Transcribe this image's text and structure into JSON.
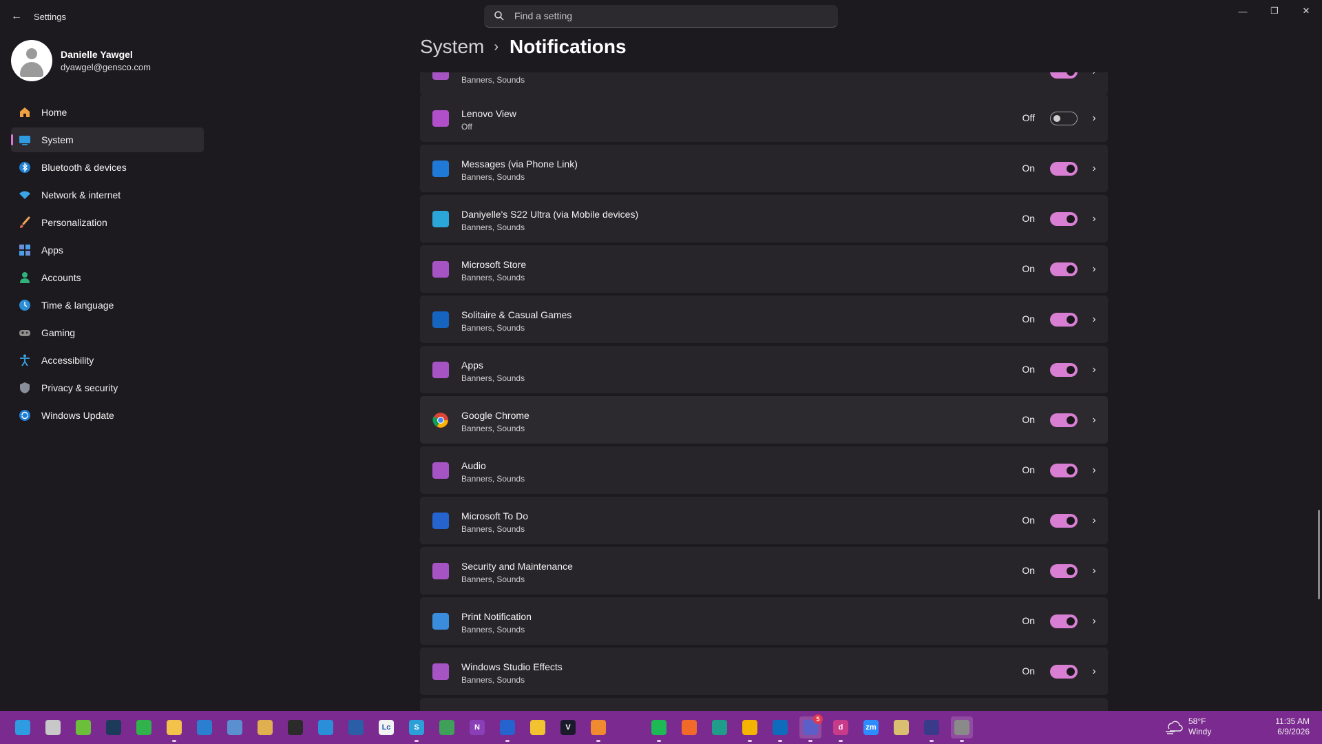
{
  "app": {
    "title": "Settings"
  },
  "search": {
    "placeholder": "Find a setting"
  },
  "profile": {
    "name": "Danielle Yawgel",
    "email": "dyawgel@gensco.com"
  },
  "nav": {
    "items": [
      {
        "label": "Home",
        "icon": "home-icon",
        "active": false
      },
      {
        "label": "System",
        "icon": "system-icon",
        "active": true
      },
      {
        "label": "Bluetooth & devices",
        "icon": "bluetooth-icon",
        "active": false
      },
      {
        "label": "Network & internet",
        "icon": "wifi-icon",
        "active": false
      },
      {
        "label": "Personalization",
        "icon": "brush-icon",
        "active": false
      },
      {
        "label": "Apps",
        "icon": "apps-icon",
        "active": false
      },
      {
        "label": "Accounts",
        "icon": "accounts-icon",
        "active": false
      },
      {
        "label": "Time & language",
        "icon": "globe-clock-icon",
        "active": false
      },
      {
        "label": "Gaming",
        "icon": "gamepad-icon",
        "active": false
      },
      {
        "label": "Accessibility",
        "icon": "accessibility-icon",
        "active": false
      },
      {
        "label": "Privacy & security",
        "icon": "shield-icon",
        "active": false
      },
      {
        "label": "Windows Update",
        "icon": "update-icon",
        "active": false
      }
    ]
  },
  "breadcrumb": {
    "parent": "System",
    "separator": "›",
    "current": "Notifications"
  },
  "notifications": {
    "partial_top": {
      "sub": "Banners, Sounds"
    },
    "apps": [
      {
        "name": "Lenovo View",
        "sub": "Off",
        "state": "Off",
        "on": false,
        "icon": "lenovo-view-icon",
        "color": "#b04fc9"
      },
      {
        "name": "Messages (via Phone Link)",
        "sub": "Banners, Sounds",
        "state": "On",
        "on": true,
        "icon": "phone-link-icon",
        "color": "#1e7ad6"
      },
      {
        "name": "Daniyelle's S22 Ultra (via Mobile devices)",
        "sub": "Banners, Sounds",
        "state": "On",
        "on": true,
        "icon": "mobile-device-icon",
        "color": "#2aa6d8"
      },
      {
        "name": "Microsoft Store",
        "sub": "Banners, Sounds",
        "state": "On",
        "on": true,
        "icon": "store-icon",
        "color": "#a653c4"
      },
      {
        "name": "Solitaire & Casual Games",
        "sub": "Banners, Sounds",
        "state": "On",
        "on": true,
        "icon": "solitaire-icon",
        "color": "#1565c0"
      },
      {
        "name": "Apps",
        "sub": "Banners, Sounds",
        "state": "On",
        "on": true,
        "icon": "apps-tile-icon",
        "color": "#a653c4"
      },
      {
        "name": "Google Chrome",
        "sub": "Banners, Sounds",
        "state": "On",
        "on": true,
        "icon": "chrome-icon",
        "color": "#ffffff"
      },
      {
        "name": "Audio",
        "sub": "Banners, Sounds",
        "state": "On",
        "on": true,
        "icon": "audio-icon",
        "color": "#a653c4"
      },
      {
        "name": "Microsoft To Do",
        "sub": "Banners, Sounds",
        "state": "On",
        "on": true,
        "icon": "todo-icon",
        "color": "#2564cf"
      },
      {
        "name": "Security and Maintenance",
        "sub": "Banners, Sounds",
        "state": "On",
        "on": true,
        "icon": "security-maintenance-icon",
        "color": "#a653c4"
      },
      {
        "name": "Print Notification",
        "sub": "Banners, Sounds",
        "state": "On",
        "on": true,
        "icon": "printer-icon",
        "color": "#3a8ddd"
      },
      {
        "name": "Windows Studio Effects",
        "sub": "Banners, Sounds",
        "state": "On",
        "on": true,
        "icon": "studio-effects-icon",
        "color": "#a653c4"
      }
    ]
  },
  "taskbar": {
    "apps": [
      {
        "icon": "start-icon",
        "label": ""
      },
      {
        "icon": "task-view-icon",
        "label": ""
      },
      {
        "icon": "arcgis-icon",
        "label": ""
      },
      {
        "icon": "camera-app-icon",
        "label": ""
      },
      {
        "icon": "plane-app-icon",
        "label": ""
      },
      {
        "icon": "file-explorer-icon",
        "label": ""
      },
      {
        "icon": "defender-icon",
        "label": ""
      },
      {
        "icon": "print-manager-icon",
        "label": ""
      },
      {
        "icon": "people-app-icon",
        "label": ""
      },
      {
        "icon": "terminal-icon",
        "label": ""
      },
      {
        "icon": "photos-icon",
        "label": ""
      },
      {
        "icon": "powershell-icon",
        "label": ""
      },
      {
        "icon": "lc-app-icon",
        "label": "Lc"
      },
      {
        "icon": "scripting-icon",
        "label": "S"
      },
      {
        "icon": "notepad-icon",
        "label": ""
      },
      {
        "icon": "onenote-icon",
        "label": "N"
      },
      {
        "icon": "todo-taskbar-icon",
        "label": ""
      },
      {
        "icon": "sticky-notes-icon",
        "label": ""
      },
      {
        "icon": "vim-icon",
        "label": "V"
      },
      {
        "icon": "tasks-app-icon",
        "label": ""
      },
      {
        "icon": "chatgpt-icon",
        "label": ""
      },
      {
        "icon": "spotify-icon",
        "label": ""
      },
      {
        "icon": "firefox-icon",
        "label": ""
      },
      {
        "icon": "edge-icon",
        "label": ""
      },
      {
        "icon": "chrome-taskbar-icon",
        "label": ""
      },
      {
        "icon": "outlook-icon",
        "label": ""
      },
      {
        "icon": "teams-icon",
        "label": "",
        "badge": "5"
      },
      {
        "icon": "design-app-icon",
        "label": "d"
      },
      {
        "icon": "zoom-icon",
        "label": "zm"
      },
      {
        "icon": "notes-app-icon",
        "label": ""
      },
      {
        "icon": "snipping-icon",
        "label": ""
      },
      {
        "icon": "settings-gear-icon",
        "label": ""
      }
    ]
  },
  "weather": {
    "temp": "58°F",
    "condition": "Windy"
  },
  "clock": {
    "time": "11:35 AM",
    "date": "6/9/2026"
  },
  "colors": {
    "accent": "#d87fd4",
    "taskbar": "#7b2a8f",
    "background": "#1c1a1f",
    "card": "#28252a"
  }
}
